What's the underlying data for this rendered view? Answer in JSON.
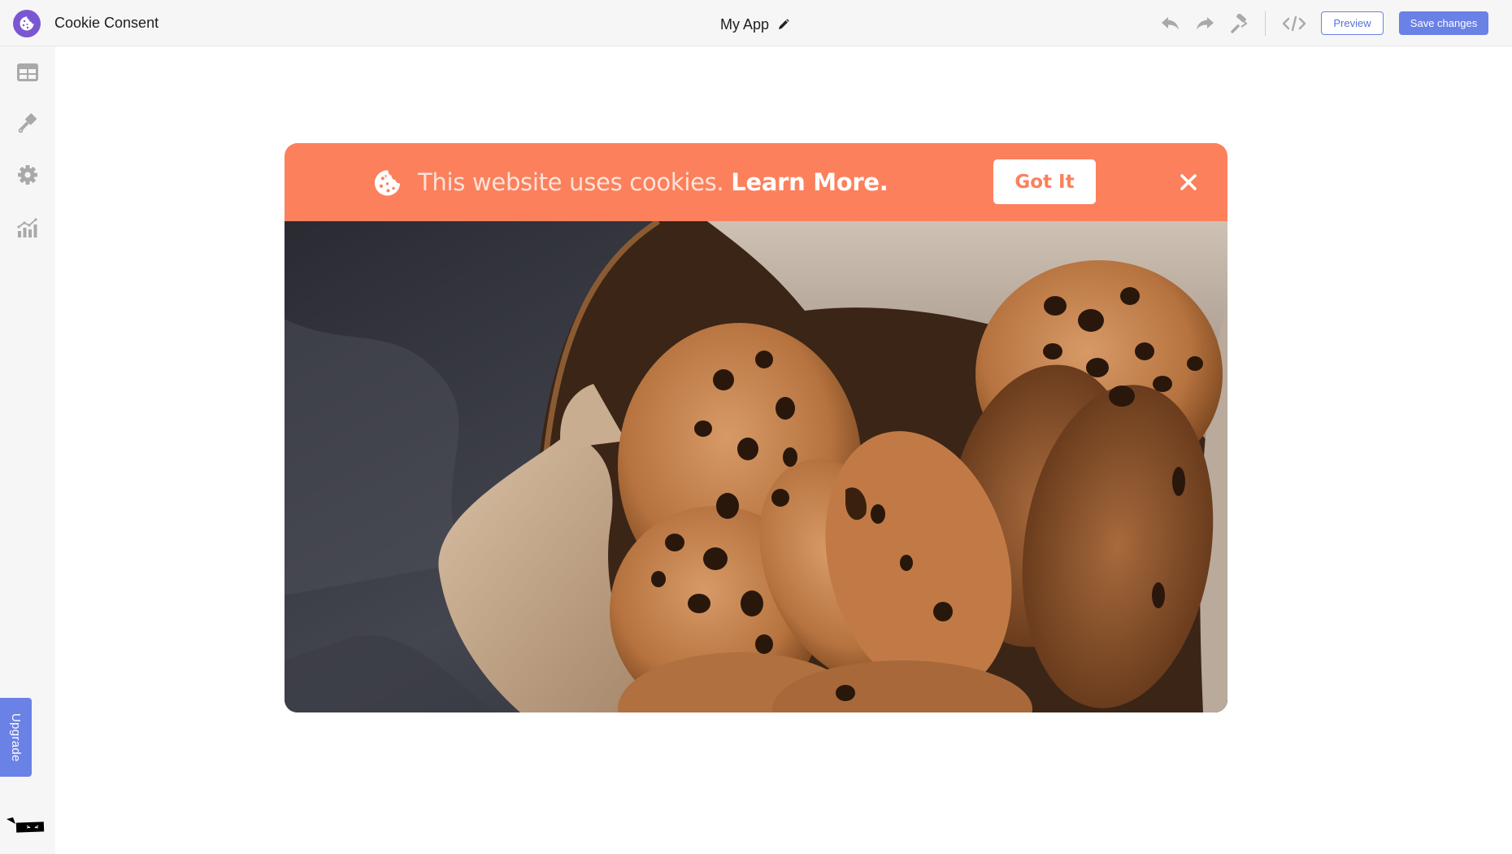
{
  "header": {
    "app_title": "Cookie Consent",
    "project_name": "My App",
    "logo_icon": "cookie-icon",
    "toolbar": {
      "undo_icon": "undo-icon",
      "redo_icon": "redo-icon",
      "paint_icon": "paint-roller-icon",
      "code_icon": "code-icon",
      "preview_label": "Preview",
      "save_label": "Save changes"
    }
  },
  "sidebar": {
    "items": [
      {
        "name": "layout",
        "icon": "table-icon"
      },
      {
        "name": "design",
        "icon": "brush-icon"
      },
      {
        "name": "settings",
        "icon": "gear-icon"
      },
      {
        "name": "analytics",
        "icon": "chart-icon"
      }
    ],
    "upgrade_label": "Upgrade"
  },
  "widget": {
    "banner": {
      "message": "This website uses cookies.",
      "link_label": "Learn More.",
      "accept_label": "Got It",
      "close_icon": "close-icon",
      "cookie_icon": "cookie-icon"
    },
    "image_description": "Chocolate chip cookies in a basket with parchment paper on a dark cloth"
  },
  "colors": {
    "brand_purple": "#7a57d1",
    "accent_blue": "#6a81e6",
    "banner_orange": "#fc805c",
    "icon_gray": "#a9a9a9"
  }
}
